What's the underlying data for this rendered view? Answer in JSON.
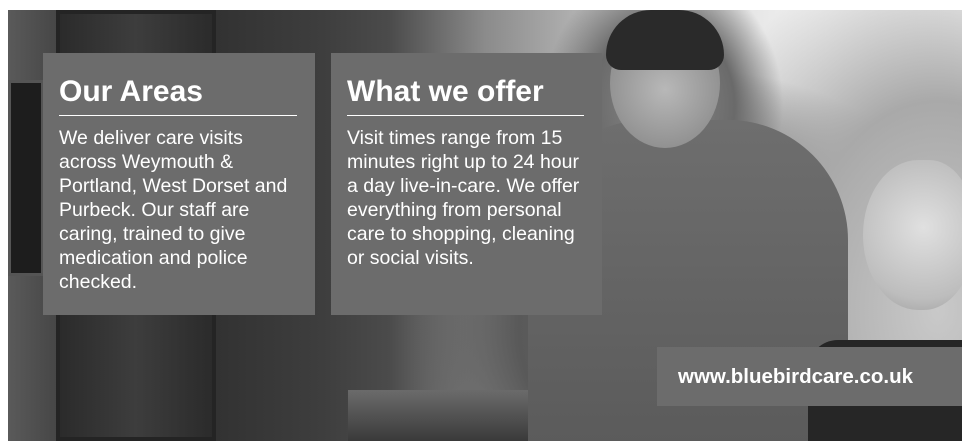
{
  "areas": {
    "title": "Our Areas",
    "body": "We deliver care visits across Weymouth & Portland, West Dorset and Purbeck. Our staff are caring, trained to give medication and police checked."
  },
  "offer": {
    "title": "What we offer",
    "body": "Visit times range from 15 minutes right up to 24 hour a day live-in-care. We offer everything from personal care to shopping, cleaning or social visits."
  },
  "website": {
    "url": "www.bluebirdcare.co.uk"
  },
  "colors": {
    "panel": "#6c6c6c",
    "text": "#ffffff"
  }
}
